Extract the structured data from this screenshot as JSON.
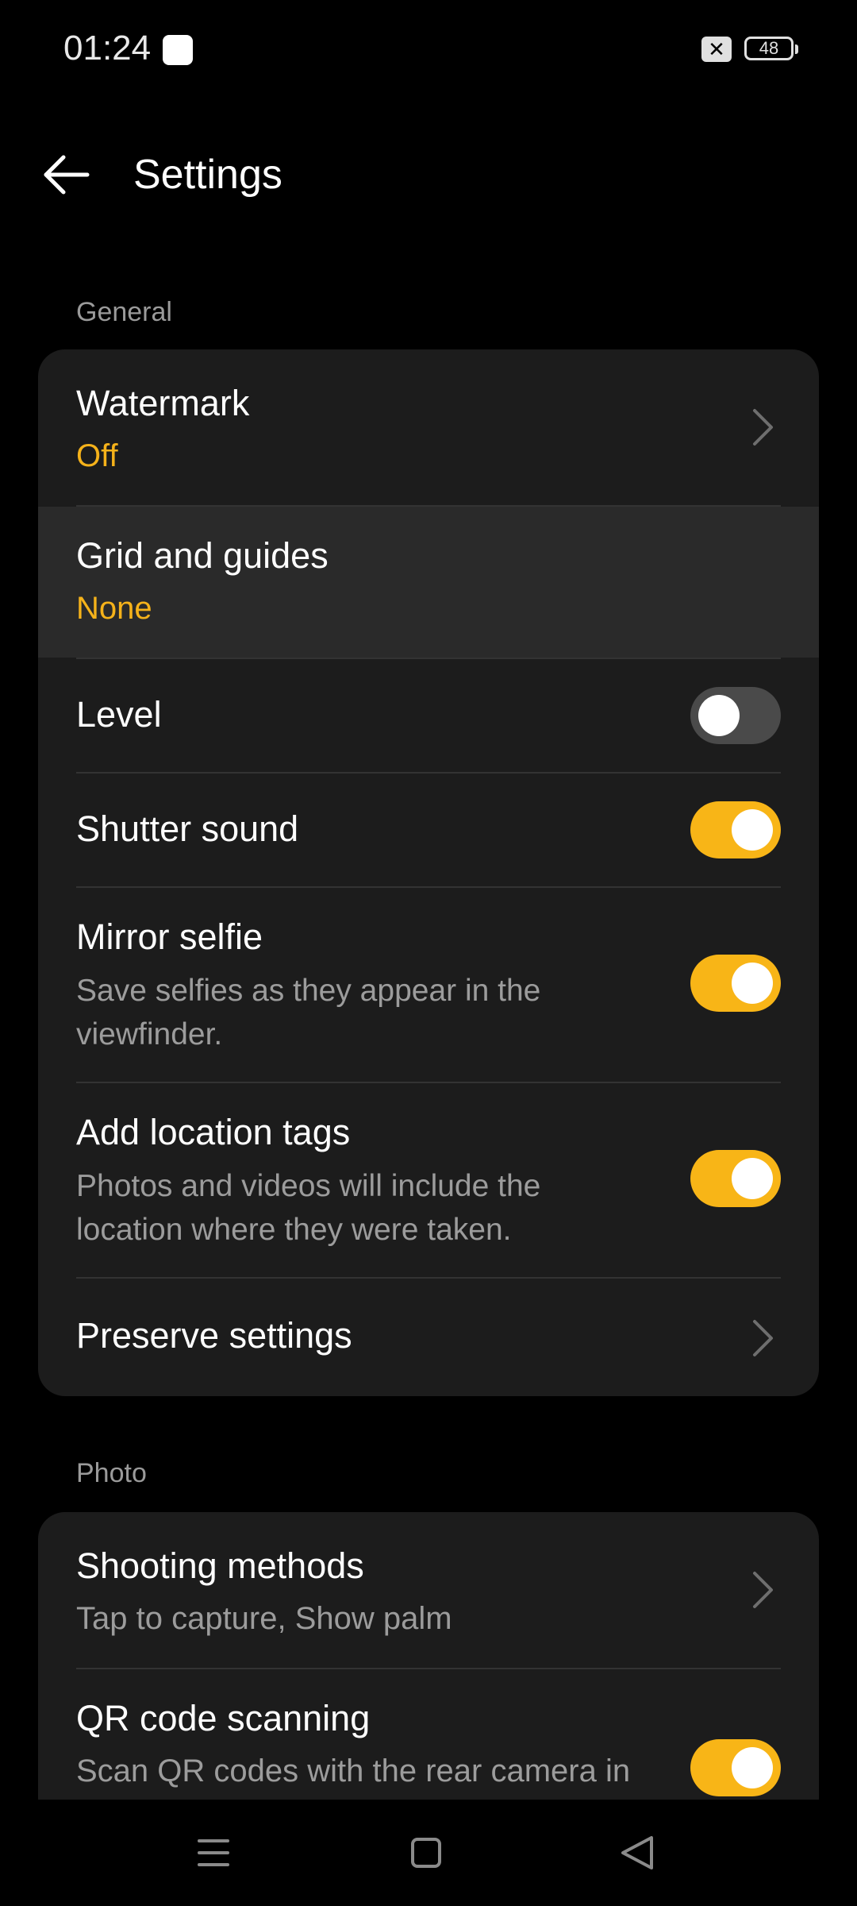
{
  "status_bar": {
    "time": "01:24",
    "app_icon": "realme-app-icon",
    "sim_icon": "no-sim-icon",
    "battery_level": "48"
  },
  "header": {
    "back_icon": "arrow-left-icon",
    "title": "Settings"
  },
  "general": {
    "label": "General",
    "watermark": {
      "title": "Watermark",
      "value": "Off"
    },
    "grid": {
      "title": "Grid and guides",
      "value": "None"
    },
    "level": {
      "title": "Level",
      "enabled": false
    },
    "shutter": {
      "title": "Shutter sound",
      "enabled": true
    },
    "mirror": {
      "title": "Mirror selfie",
      "subtitle": "Save selfies as they appear in the viewfinder.",
      "enabled": true
    },
    "location": {
      "title": "Add location tags",
      "subtitle": "Photos and videos will include the location where they were taken.",
      "enabled": true
    },
    "preserve": {
      "title": "Preserve settings"
    }
  },
  "photo": {
    "label": "Photo",
    "shooting": {
      "title": "Shooting methods",
      "subtitle": "Tap to capture, Show palm"
    },
    "qr": {
      "title": "QR code scanning",
      "subtitle": "Scan QR codes with the rear camera in",
      "enabled": true
    }
  },
  "nav": {
    "menu_icon": "menu-icon",
    "home_icon": "home-square-icon",
    "back_icon": "back-triangle-icon"
  },
  "colors": {
    "accent": "#f8b517",
    "value_text": "#f5b21a",
    "card_bg": "#1c1c1c",
    "background": "#000000"
  }
}
